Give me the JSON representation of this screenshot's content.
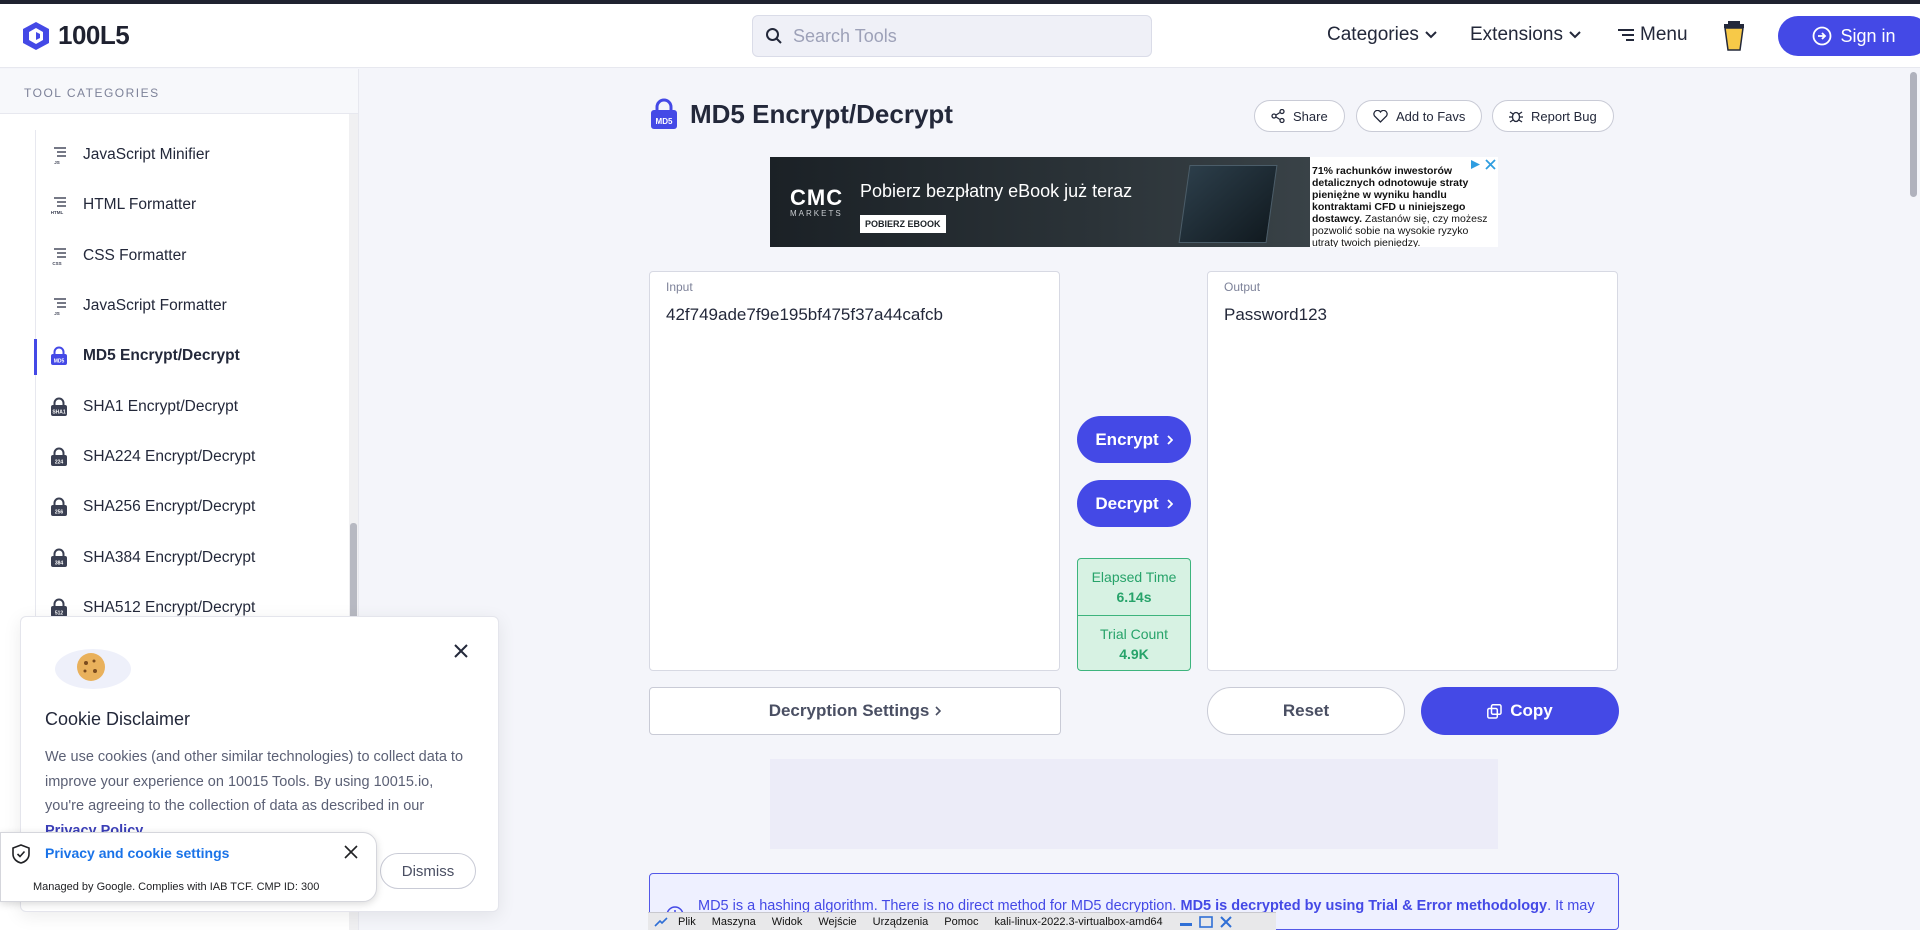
{
  "header": {
    "logo_text": "100L5",
    "search_placeholder": "Search Tools",
    "nav": {
      "categories": "Categories",
      "extensions": "Extensions",
      "menu": "Menu",
      "signin": "Sign in"
    }
  },
  "sidebar": {
    "heading": "TOOL CATEGORIES",
    "items": [
      {
        "label": "JavaScript Minifier",
        "icon": "js-minifier-icon",
        "badge": "JS"
      },
      {
        "label": "HTML Formatter",
        "icon": "html-formatter-icon",
        "badge": "HTML"
      },
      {
        "label": "CSS Formatter",
        "icon": "css-formatter-icon",
        "badge": "CSS"
      },
      {
        "label": "JavaScript Formatter",
        "icon": "js-formatter-icon",
        "badge": "JS"
      },
      {
        "label": "MD5 Encrypt/Decrypt",
        "icon": "md5-lock-icon",
        "badge": "MD5",
        "active": true
      },
      {
        "label": "SHA1 Encrypt/Decrypt",
        "icon": "sha1-lock-icon",
        "badge": "SHA1"
      },
      {
        "label": "SHA224 Encrypt/Decrypt",
        "icon": "sha224-lock-icon",
        "badge": "224"
      },
      {
        "label": "SHA256 Encrypt/Decrypt",
        "icon": "sha256-lock-icon",
        "badge": "256"
      },
      {
        "label": "SHA384 Encrypt/Decrypt",
        "icon": "sha384-lock-icon",
        "badge": "384"
      },
      {
        "label": "SHA512 Encrypt/Decrypt",
        "icon": "sha512-lock-icon",
        "badge": "512"
      }
    ]
  },
  "tool": {
    "title": "MD5 Encrypt/Decrypt",
    "title_badge": "MD5",
    "actions": {
      "share": "Share",
      "add_to_favs": "Add to Favs",
      "report_bug": "Report Bug"
    }
  },
  "ad_banner": {
    "brand": "CMC",
    "brand_sub": "MARKETS",
    "headline": "Pobierz bezpłatny eBook już teraz",
    "cta": "POBIERZ EBOOK",
    "disclaimer_bold": "71% rachunków inwestorów detalicznych odnotowuje straty pieniężne w wyniku handlu kontraktami CFD u niniejszego dostawcy.",
    "disclaimer_rest": "Zastanów się, czy możesz pozwolić sobie na wysokie ryzyko utraty twoich pieniędzy."
  },
  "input": {
    "label": "Input",
    "value": "42f749ade7f9e195bf475f37a44cafcb"
  },
  "output": {
    "label": "Output",
    "value": "Password123"
  },
  "controls": {
    "encrypt": "Encrypt",
    "decrypt": "Decrypt"
  },
  "stats": {
    "elapsed_label": "Elapsed Time",
    "elapsed_value": "6.14s",
    "trial_label": "Trial Count",
    "trial_value": "4.9K"
  },
  "bottom_buttons": {
    "settings": "Decryption Settings",
    "reset": "Reset",
    "copy": "Copy"
  },
  "info": {
    "text_start": "MD5 is a hashing algorithm. There is no direct method for MD5 decryption.",
    "text_bold": "MD5 is decrypted by using Trial & Error methodology",
    "text_end": ". It may take decryption is long."
  },
  "cookie": {
    "title": "Cookie Disclaimer",
    "body": "We use cookies (and other similar technologies) to collect data to improve your experience on 10015 Tools. By using 10015.io, you're agreeing to the collection of data as described in our",
    "link": "Privacy Policy",
    "dismiss": "Dismiss"
  },
  "gdpr": {
    "title": "Privacy and cookie settings",
    "subtitle": "Managed by Google. Complies with IAB TCF. CMP ID: 300"
  },
  "vbox_bar": {
    "items": [
      "Plik",
      "Maszyna",
      "Widok",
      "Wejście",
      "Urządzenia",
      "Pomoc"
    ],
    "vm_name": "kali-linux-2022.3-virtualbox-amd64"
  },
  "colors": {
    "accent": "#4449e6",
    "success": "#27a36a",
    "success_bg": "#d7f2e3"
  }
}
